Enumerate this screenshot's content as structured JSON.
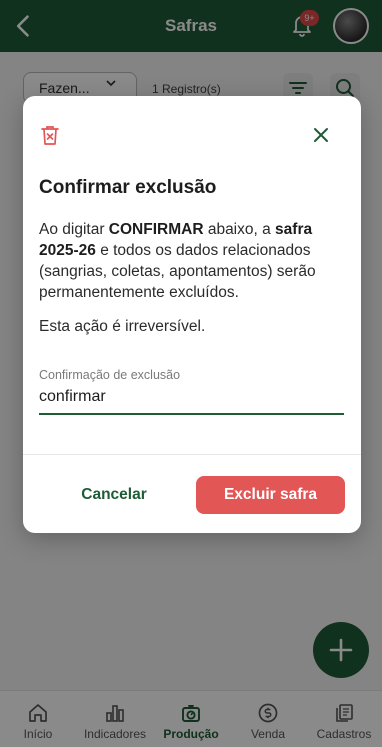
{
  "header": {
    "title": "Safras",
    "notification_badge": "9+",
    "back_icon": "arrow-left-icon",
    "bell_icon": "bell-icon"
  },
  "filters": {
    "farm_select_value": "Fazen...",
    "records_count": "1 Registro(s)",
    "filter_icon": "filter-icon",
    "search_icon": "search-icon"
  },
  "fab": {
    "icon": "plus-icon"
  },
  "bottom_nav": {
    "items": [
      {
        "label": "Início",
        "icon": "home-icon"
      },
      {
        "label": "Indicadores",
        "icon": "bar-chart-icon"
      },
      {
        "label": "Produção",
        "icon": "scale-icon"
      },
      {
        "label": "Venda",
        "icon": "dollar-coin-icon"
      },
      {
        "label": "Cadastros",
        "icon": "documents-icon"
      }
    ],
    "active": "Produção"
  },
  "dialog": {
    "title": "Confirmar exclusão",
    "body_prefix": "Ao digitar ",
    "keyword": "CONFIRMAR",
    "body_middle": " abaixo, a ",
    "subject": "safra 2025-26",
    "body_suffix": " e todos os dados relacionados (sangrias, coletas, apontamentos) serão permanentemente excluídos.",
    "note": "Esta ação é irreversível.",
    "field_label": "Confirmação de exclusão",
    "field_value": "confirmar",
    "cancel_label": "Cancelar",
    "delete_label": "Excluir safra"
  },
  "colors": {
    "brand_green": "#1f5c36",
    "danger_red": "#e25656",
    "badge_red": "#e24848"
  }
}
